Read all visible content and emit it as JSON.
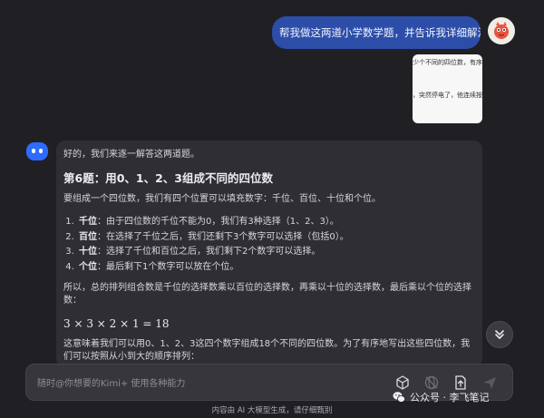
{
  "chat": {
    "user_message": "帮我做这两道小学数学题，并告诉我详细解法。",
    "attachment": {
      "line1": "少个不同的四位数，有序",
      "line2": "，突然停电了，他连续按"
    }
  },
  "answer": {
    "intro": "好的，我们来逐一解答这两道题。",
    "heading": "第6题：用0、1、2、3组成不同的四位数",
    "para1": "要组成一个四位数，我们有四个位置可以填充数字：千位、百位、十位和个位。",
    "steps": [
      {
        "num": "1.",
        "label": "千位",
        "text": "：由于四位数的千位不能为0，我们有3种选择（1、2、3）。"
      },
      {
        "num": "2.",
        "label": "百位",
        "text": "：在选择了千位之后，我们还剩下3个数字可以选择（包括0）。"
      },
      {
        "num": "3.",
        "label": "十位",
        "text": "：选择了千位和百位之后，我们剩下2个数字可以选择。"
      },
      {
        "num": "4.",
        "label": "个位",
        "text": "：最后剩下1个数字可以放在个位。"
      }
    ],
    "para2": "所以，总的排列组合数是千位的选择数乘以百位的选择数，再乘以十位的选择数，最后乘以个位的选择数：",
    "equation": "3 × 3 × 2 × 1 = 18",
    "para3": "这意味着我们可以用0、1、2、3这四个数字组成18个不同的四位数。为了有序地写出这些四位数，我们可以按照从小到大的顺序排列："
  },
  "composer": {
    "placeholder": "随时@你想要的Kimi+ 使用各种能力"
  },
  "watermark": "公众号 · 李飞笔记",
  "footer": "内容由 AI 大模型生成，请仔细甄别",
  "colors": {
    "background": "#202024",
    "user_bubble": "#2c4ea8",
    "bot_bubble": "#2e2e34",
    "bot_avatar": "#2d6cff"
  },
  "icons": [
    "avatar-dragon-icon",
    "bot-face-icon",
    "chevron-double-down-icon",
    "cube-icon",
    "globe-off-icon",
    "upload-file-icon",
    "send-icon",
    "wechat-icon"
  ]
}
